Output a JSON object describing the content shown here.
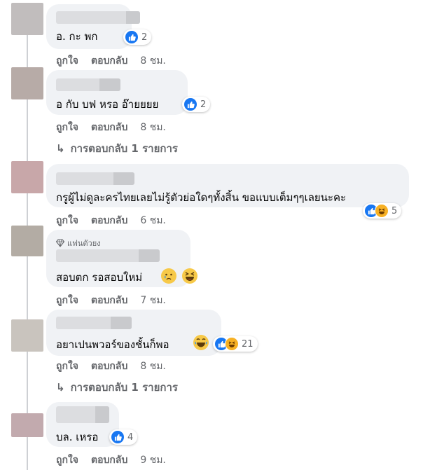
{
  "comments": [
    {
      "text": "อ. กะ พก",
      "reaction_count": "2",
      "action_like": "ถูกใจ",
      "action_reply": "ตอบกลับ",
      "time": "8 ชม."
    },
    {
      "text": "อ กับ บฟ หรอ อ๊ายยยย",
      "reaction_count": "2",
      "action_like": "ถูกใจ",
      "action_reply": "ตอบกลับ",
      "time": "8 ชม.",
      "replies_label": "การตอบกลับ 1 รายการ"
    },
    {
      "text": "กรูผู้ไม่ดูละครไทยเลยไม่รู้ตัวย่อใดๆทั้งสิ้น ขอแบบเต็มๆๆเลยนะคะ",
      "reaction_count": "5",
      "action_like": "ถูกใจ",
      "action_reply": "ตอบกลับ",
      "time": "6 ชม."
    },
    {
      "badge": "แฟนตัวยง",
      "text": "สอบตก รอสอบใหม่",
      "action_like": "ถูกใจ",
      "action_reply": "ตอบกลับ",
      "time": "7 ชม."
    },
    {
      "text": "อยาเปนพวอร์ของชั้นก็พอ",
      "reaction_count": "21",
      "action_like": "ถูกใจ",
      "action_reply": "ตอบกลับ",
      "time": "8 ชม.",
      "replies_label": "การตอบกลับ 1 รายการ"
    },
    {
      "text": "บล. เหรอ",
      "reaction_count": "4",
      "action_like": "ถูกใจ",
      "action_reply": "ตอบกลับ",
      "time": "9 ชม."
    }
  ],
  "icons": {
    "like": "thumbs-up-icon",
    "haha": "laughing-face-icon",
    "badge": "diamond-icon",
    "reply_arrow": "reply-arrow-icon"
  },
  "colors": {
    "bubble": "#f0f2f5",
    "like_blue": "#1877f2",
    "haha_yellow": "#f7b125",
    "muted_text": "#65676b"
  }
}
